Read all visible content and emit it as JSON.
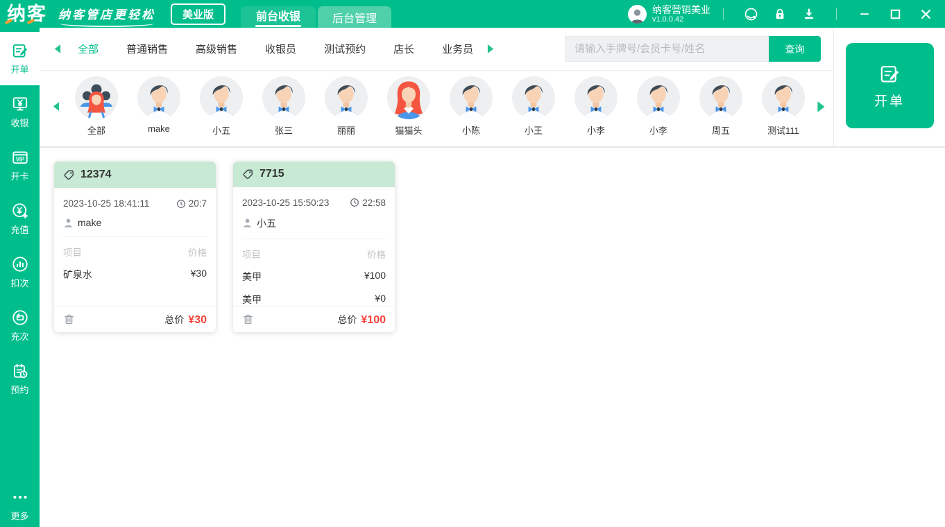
{
  "colors": {
    "accent_green": "#00be8c",
    "tab_active_green": "#1bc395",
    "tab_inactive_green": "#4fd0a9",
    "card_header_green": "#c8e9d3",
    "total_red": "#f6423a",
    "logo_accent_orange": "#ff9b30"
  },
  "titlebar": {
    "logo": "纳客",
    "slogan": "纳客管店更轻松",
    "edition": "美业版",
    "tabs": [
      {
        "label": "前台收银",
        "active": true
      },
      {
        "label": "后台管理",
        "active": false
      }
    ],
    "account": {
      "name": "纳客营销美业",
      "version": "v1.0.0.42"
    },
    "icons": [
      "user-avatar",
      "support-icon",
      "lock-icon",
      "download-icon",
      "minimize-icon",
      "maximize-icon",
      "close-icon"
    ]
  },
  "sidebar": {
    "items": [
      {
        "label": "开单",
        "icon": "order-doc-pen",
        "active": true
      },
      {
        "label": "收银",
        "icon": "cashier-monitor",
        "active": false
      },
      {
        "label": "开卡",
        "icon": "vip-card",
        "icon_text": "VIP",
        "active": false
      },
      {
        "label": "充值",
        "icon": "recharge-yuan-plus",
        "active": false
      },
      {
        "label": "扣次",
        "icon": "deduct-chart",
        "active": false
      },
      {
        "label": "充次",
        "icon": "refill-repeat",
        "active": false
      },
      {
        "label": "预约",
        "icon": "booking-clipboard-clock",
        "active": false
      }
    ],
    "more_label": "更多"
  },
  "filters": {
    "tabs": [
      {
        "label": "全部",
        "active": true
      },
      {
        "label": "普通销售",
        "active": false
      },
      {
        "label": "高级销售",
        "active": false
      },
      {
        "label": "收银员",
        "active": false
      },
      {
        "label": "测试预约",
        "active": false
      },
      {
        "label": "店长",
        "active": false
      },
      {
        "label": "业务员",
        "active": false
      }
    ]
  },
  "search": {
    "placeholder": "请输入手牌号/会员卡号/姓名",
    "button": "查询"
  },
  "new_order": {
    "label": "开单"
  },
  "staff": [
    {
      "name": "全部",
      "type": "group"
    },
    {
      "name": "make",
      "type": "male"
    },
    {
      "name": "小五",
      "type": "male"
    },
    {
      "name": "张三",
      "type": "male"
    },
    {
      "name": "丽丽",
      "type": "male"
    },
    {
      "name": "猫猫头",
      "type": "female"
    },
    {
      "name": "小陈",
      "type": "male"
    },
    {
      "name": "小王",
      "type": "male"
    },
    {
      "name": "小李",
      "type": "male"
    },
    {
      "name": "小李",
      "type": "male"
    },
    {
      "name": "周五",
      "type": "male"
    },
    {
      "name": "测试111",
      "type": "male"
    }
  ],
  "orders": {
    "columns": {
      "item": "项目",
      "price": "价格"
    },
    "total_label": "总价",
    "cards": [
      {
        "tag": "12374",
        "datetime": "2023-10-25 18:41:11",
        "duration": "20:7",
        "staff": "make",
        "items": [
          {
            "name": "矿泉水",
            "price": "¥30"
          }
        ],
        "total": "¥30"
      },
      {
        "tag": "7715",
        "datetime": "2023-10-25 15:50:23",
        "duration": "22:58",
        "staff": "小五",
        "items": [
          {
            "name": "美甲",
            "price": "¥100"
          },
          {
            "name": "美甲",
            "price": "¥0"
          }
        ],
        "total": "¥100"
      }
    ]
  }
}
